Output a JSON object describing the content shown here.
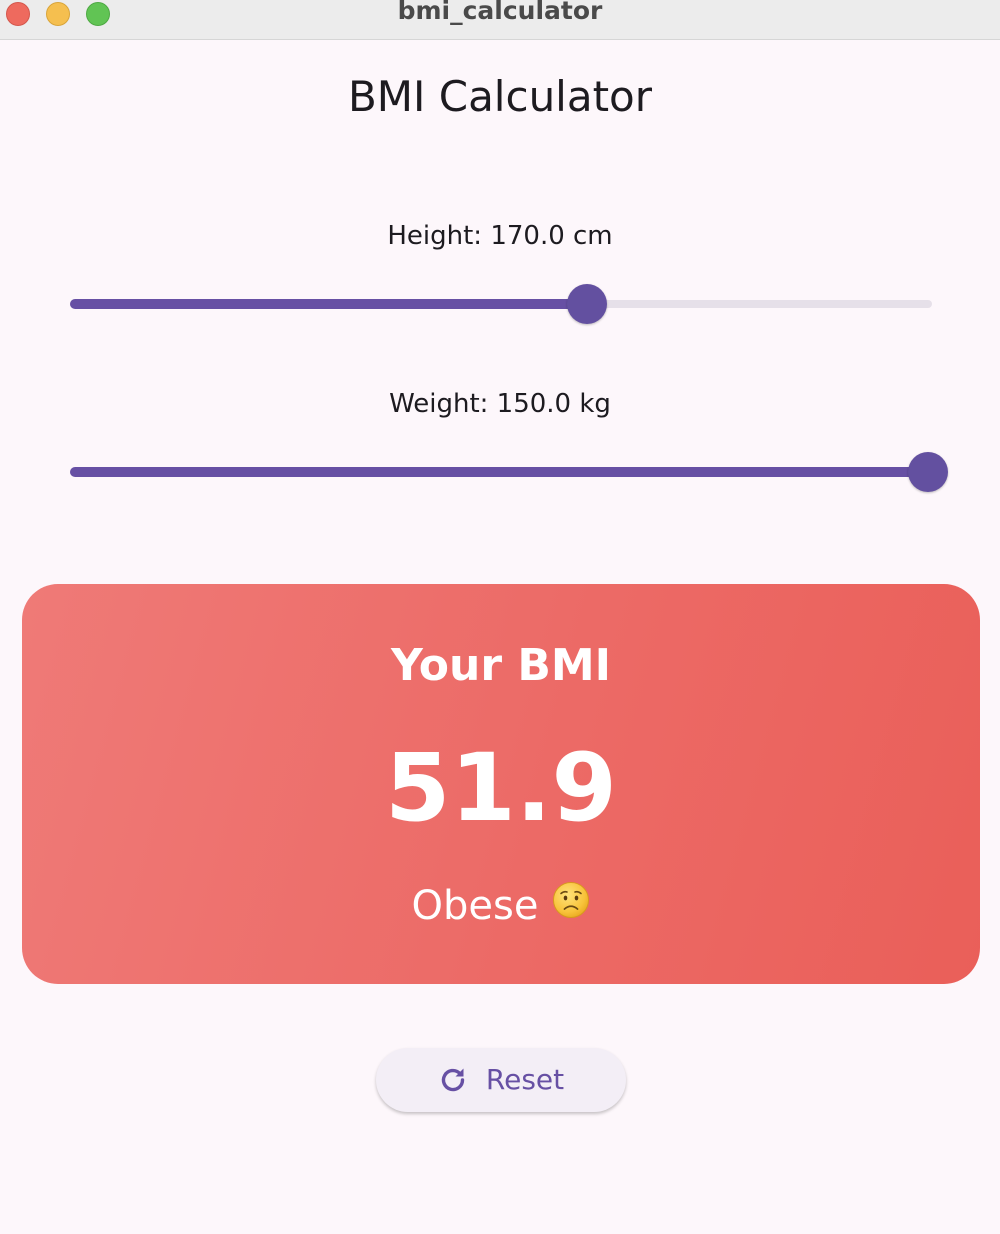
{
  "window": {
    "title": "bmi_calculator"
  },
  "app": {
    "title": "BMI Calculator"
  },
  "height_slider": {
    "label": "Height: 170.0 cm",
    "level": 0.6
  },
  "weight_slider": {
    "label": "Weight: 150.0 kg",
    "level": 1.0
  },
  "result": {
    "heading": "Your BMI",
    "value": "51.9",
    "category": "Obese",
    "category_icon": "worried-face-emoji"
  },
  "reset_button": {
    "label": "Reset",
    "icon": "refresh-icon"
  },
  "colors": {
    "accent": "#6750a4",
    "inactive_track": "#e6e0e9",
    "card_gradient_start": "#ef7a77",
    "card_gradient_end": "#ea5f59",
    "background": "#fdf7fb"
  }
}
